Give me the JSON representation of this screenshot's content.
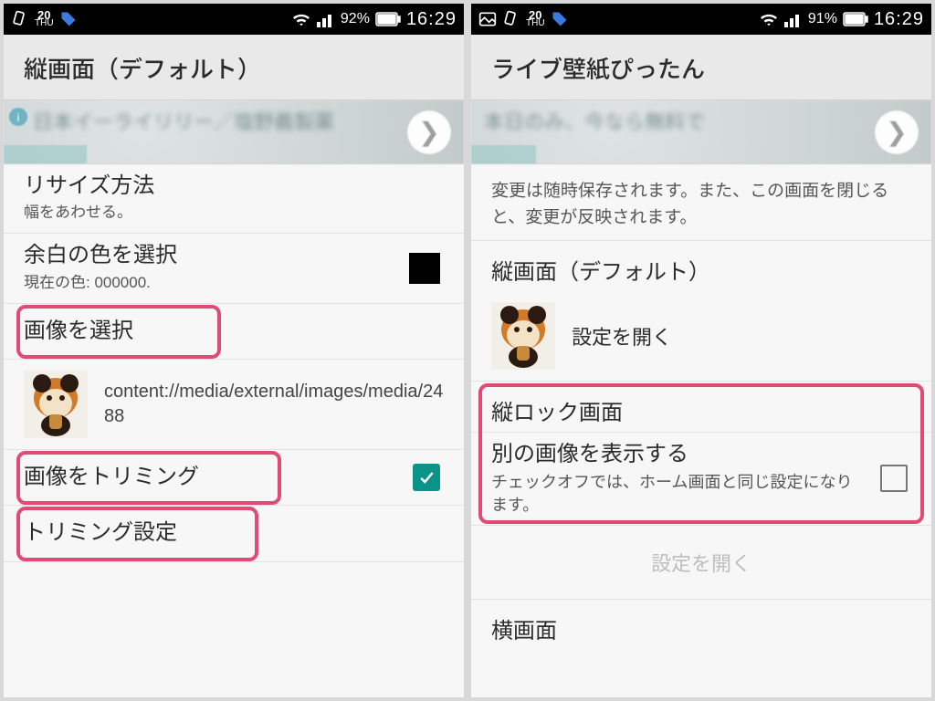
{
  "left": {
    "status": {
      "battery_pct": "92%",
      "time": "16:29",
      "cal_day": "20",
      "cal_dow": "THU"
    },
    "title": "縦画面（デフォルト）",
    "ad": {
      "text": "日本イーライリリー／塩野義製薬",
      "bar_width_pct": 18
    },
    "rows": {
      "resize": {
        "title": "リサイズ方法",
        "sub": "幅をあわせる。"
      },
      "bgcolor": {
        "title": "余白の色を選択",
        "sub": "現在の色: 000000.",
        "swatch": "#000000"
      },
      "select_image": "画像を選択",
      "thumb_path": "content://media/external/images/media/2488",
      "trim_image": "画像をトリミング",
      "trim_settings": "トリミング設定"
    }
  },
  "right": {
    "status": {
      "battery_pct": "91%",
      "time": "16:29",
      "cal_day": "20",
      "cal_dow": "THU"
    },
    "title": "ライブ壁紙ぴったん",
    "ad": {
      "text": "本日のみ、今なら無料で",
      "bar_width_pct": 14
    },
    "note": "変更は随時保存されます。また、この画面を閉じると、変更が反映されます。",
    "sections": {
      "portrait": {
        "header": "縦画面（デフォルト）",
        "open": "設定を開く"
      },
      "lock": {
        "header": "縦ロック画面",
        "title": "別の画像を表示する",
        "sub": "チェックオフでは、ホーム画面と同じ設定になります。",
        "open": "設定を開く"
      },
      "landscape_header": "横画面"
    }
  },
  "icons": {
    "rotate": "rotate-icon",
    "calendar": "calendar-icon",
    "tag": "tag-icon",
    "picture": "picture-icon",
    "wifi": "wifi-icon",
    "signal": "signal-icon",
    "battery": "battery-icon"
  }
}
